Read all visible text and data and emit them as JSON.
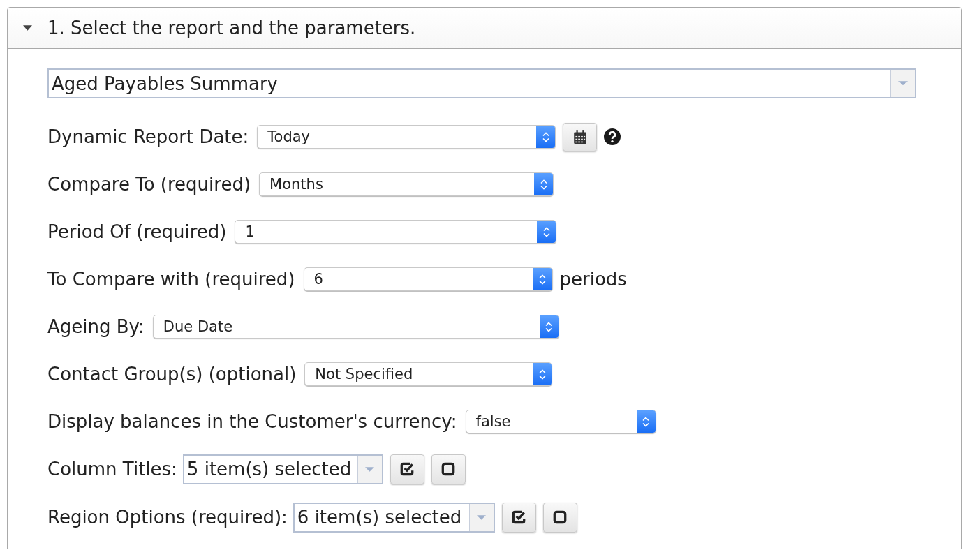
{
  "panel": {
    "title": "1. Select the report and the parameters.",
    "expanded": true
  },
  "report": {
    "value": "Aged Payables Summary"
  },
  "parameters": [
    {
      "kind": "select",
      "label": "Dynamic Report Date:",
      "value": "Today",
      "calendar": true,
      "help": true
    },
    {
      "kind": "select",
      "label": "Compare To (required)",
      "value": "Months"
    },
    {
      "kind": "select",
      "label": "Period Of (required)",
      "value": "1"
    },
    {
      "kind": "select",
      "label": "To Compare with (required)",
      "value": "6",
      "suffix": "periods"
    },
    {
      "kind": "select",
      "label": "Ageing By:",
      "value": "Due Date"
    },
    {
      "kind": "select",
      "label": "Contact Group(s) (optional)",
      "value": "Not Specified"
    },
    {
      "kind": "select",
      "label": "Display balances in the Customer's currency:",
      "value": "false"
    },
    {
      "kind": "multiselect",
      "label": "Column Titles:",
      "value": "5 item(s) selected"
    },
    {
      "kind": "multiselect",
      "label": "Region Options (required):",
      "value": "6 item(s) selected"
    }
  ]
}
